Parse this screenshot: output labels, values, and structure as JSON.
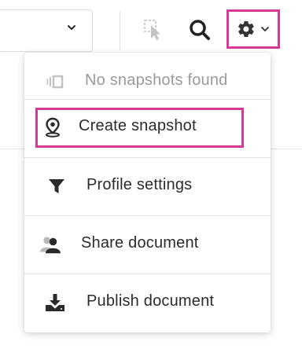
{
  "toolbar": {
    "select_chevron_icon": "chevron-down-icon",
    "cursor_icon": "select-cursor-icon",
    "search_icon": "search-icon",
    "settings_icon": "gear-icon"
  },
  "menu": {
    "items": [
      {
        "label": "No snapshots found",
        "icon": "snapshot-list-icon",
        "disabled": true
      },
      {
        "label": "Create snapshot",
        "icon": "location-pin-icon",
        "highlighted": true
      },
      {
        "label": "Profile settings",
        "icon": "filter-icon"
      },
      {
        "label": "Share document",
        "icon": "users-icon"
      },
      {
        "label": "Publish document",
        "icon": "download-icon"
      }
    ]
  },
  "colors": {
    "highlight": "#d63a97",
    "text": "#2b2b2b",
    "disabled_text": "#9a9a9a",
    "icon_dark": "#2a2a2a",
    "icon_muted": "#c4c4c4"
  }
}
